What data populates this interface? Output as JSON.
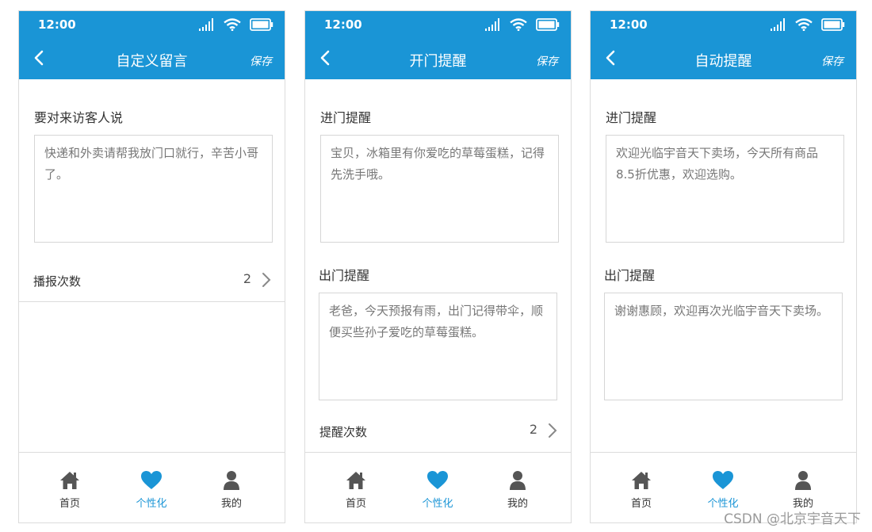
{
  "colors": {
    "accent": "#1a95d6",
    "border": "#dcdcdc",
    "icon_gray": "#555555"
  },
  "status_bar": {
    "time": "12:00"
  },
  "common": {
    "save_label": "保存",
    "count_value": "2"
  },
  "tabs": [
    {
      "label": "首页",
      "icon": "home-icon"
    },
    {
      "label": "个性化",
      "icon": "heart-icon",
      "active": true
    },
    {
      "label": "我的",
      "icon": "user-icon"
    }
  ],
  "screens": [
    {
      "title": "自定义留言",
      "field": {
        "label": "要对来访客人说",
        "text": "快递和外卖请帮我放门口就行，辛苦小哥了。"
      },
      "count_row": {
        "label": "播报次数",
        "value": "2"
      }
    },
    {
      "title": "开门提醒",
      "enter": {
        "label": "进门提醒",
        "text": "宝贝，冰箱里有你爱吃的草莓蛋糕，记得先洗手哦。"
      },
      "exit": {
        "label": "出门提醒",
        "text": "老爸，今天预报有雨，出门记得带伞，顺便买些孙子爱吃的草莓蛋糕。"
      },
      "count_row": {
        "label": "提醒次数",
        "value": "2"
      }
    },
    {
      "title": "自动提醒",
      "enter": {
        "label": "进门提醒",
        "text": "欢迎光临宇音天下卖场，今天所有商品8.5折优惠，欢迎选购。"
      },
      "exit": {
        "label": "出门提醒",
        "text": "谢谢惠顾，欢迎再次光临宇音天下卖场。"
      }
    }
  ],
  "watermark": "CSDN @北京宇音天下"
}
